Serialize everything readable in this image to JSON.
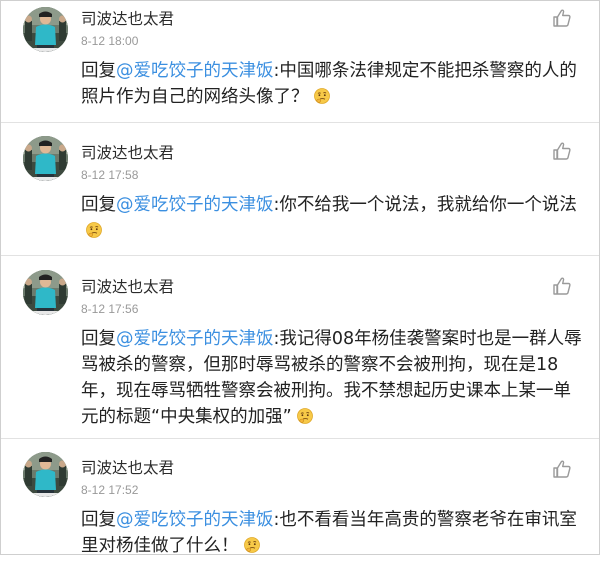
{
  "comments": [
    {
      "username": "司波达也太君",
      "time": "8-12 18:00",
      "reply_prefix": "回复",
      "mention": "@爱吃饺子的天津饭",
      "text": ":中国哪条法律规定不能把杀警察的人的照片作为自己的网络头像了？",
      "emoji": "thinking-face-icon"
    },
    {
      "username": "司波达也太君",
      "time": "8-12 17:58",
      "reply_prefix": "回复",
      "mention": "@爱吃饺子的天津饭",
      "text": ":你不给我一个说法，我就给你一个说法",
      "emoji": "thinking-face-icon"
    },
    {
      "username": "司波达也太君",
      "time": "8-12 17:56",
      "reply_prefix": "回复",
      "mention": "@爱吃饺子的天津饭",
      "text": ":我记得08年杨佳袭警案时也是一群人辱骂被杀的警察，但那时辱骂被杀的警察不会被刑拘，现在是18年，现在辱骂牺牲警察会被刑拘。我不禁想起历史课本上某一单元的标题“中央集权的加强”",
      "emoji": "thinking-face-icon"
    },
    {
      "username": "司波达也太君",
      "time": "8-12 17:52",
      "reply_prefix": "回复",
      "mention": "@爱吃饺子的天津饭",
      "text": ":也不看看当年高贵的警察老爷在审讯室里对杨佳做了什么！",
      "emoji": "thinking-face-icon"
    }
  ],
  "colors": {
    "mention": "#3b8fe0",
    "time": "#999999",
    "divider": "#e2e2e2"
  }
}
